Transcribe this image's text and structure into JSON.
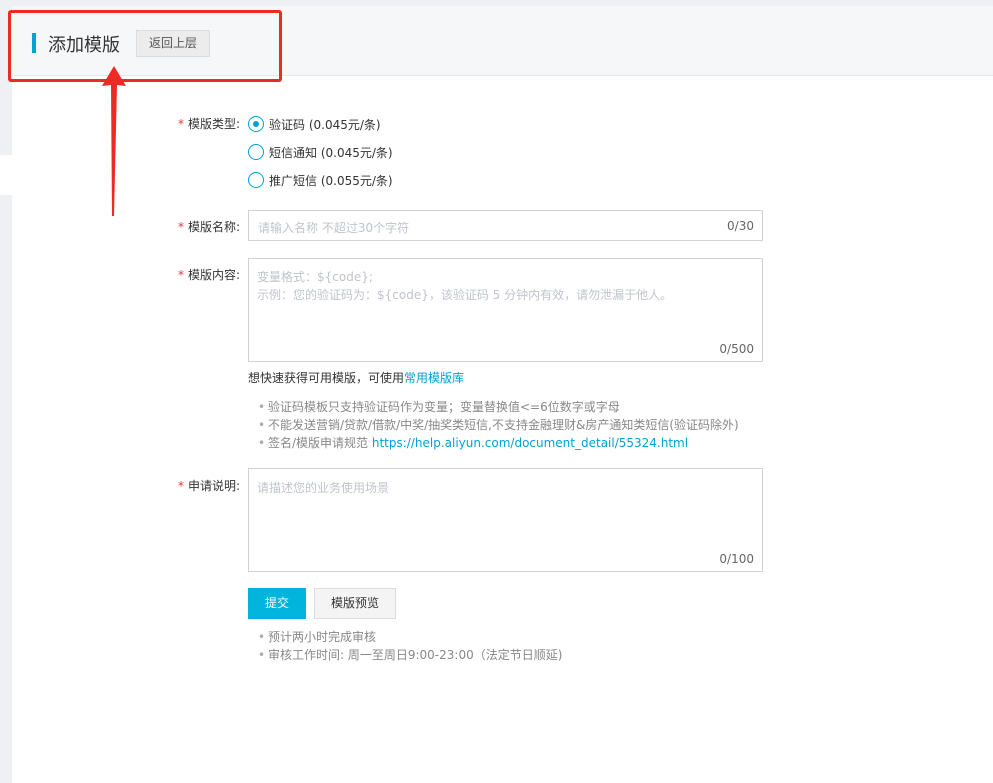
{
  "header": {
    "title": "添加模版",
    "back_label": "返回上层"
  },
  "form": {
    "required_mark": "*",
    "type": {
      "label": "模版类型:",
      "options": [
        {
          "label": "验证码 (0.045元/条)",
          "checked": true
        },
        {
          "label": "短信通知 (0.045元/条)",
          "checked": false
        },
        {
          "label": "推广短信 (0.055元/条)",
          "checked": false
        }
      ]
    },
    "name": {
      "label": "模版名称:",
      "placeholder": "请输入名称 不超过30个字符",
      "counter": "0/30"
    },
    "content": {
      "label": "模版内容:",
      "placeholder_line1": "变量格式：${code};",
      "placeholder_line2": " 示例：您的验证码为：${code}，该验证码 5 分钟内有效，请勿泄漏于他人。",
      "counter": "0/500"
    },
    "library_hint": {
      "text": "想快速获得可用模版，可使用",
      "link": "常用模版库"
    },
    "rules": [
      "验证码模板只支持验证码作为变量；变量替换值<=6位数字或字母",
      "不能发送营销/贷款/借款/中奖/抽奖类短信,不支持金融理财&房产通知类短信(验证码除外)"
    ],
    "spec": {
      "text": "签名/模版申请规范 ",
      "link": "https://help.aliyun.com/document_detail/55324.html"
    },
    "description": {
      "label": "申请说明:",
      "placeholder": "请描述您的业务使用场景",
      "counter": "0/100"
    },
    "submit_label": "提交",
    "preview_label": "模版预览",
    "notes": [
      "预计两小时完成审核",
      "审核工作时间: 周一至周日9:00-23:00（法定节日顺延)"
    ]
  },
  "colors": {
    "accent": "#00a2d4",
    "primary_button": "#00b4dc",
    "required": "#e4393c",
    "annotation": "#ee2a24"
  }
}
